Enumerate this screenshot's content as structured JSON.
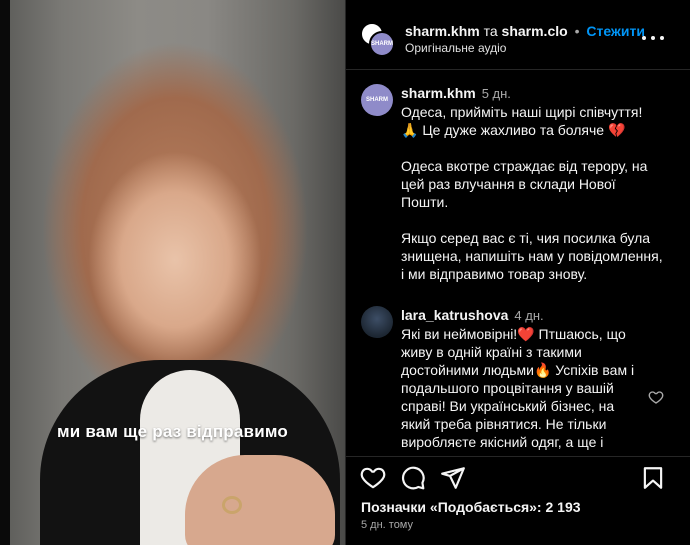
{
  "video": {
    "caption": "ми вам ще раз відправимо"
  },
  "header": {
    "user1": "sharm.khm",
    "joiner": "та",
    "user2": "sharm.clo",
    "separator": "•",
    "follow_label": "Стежити",
    "audio": "Оригінальне аудіо",
    "avatar_text": "SHARM",
    "more_icon": "more-horizontal-icon"
  },
  "comments": [
    {
      "username": "sharm.khm",
      "time": "5 дн.",
      "avatar_text": "SHARM",
      "lines": [
        "Одеса, прийміть наші щирі співчуття!",
        "🙏 Це дуже жахливо та боляче 💔",
        "",
        "Одеса вкотре страждає від терору, на",
        "цей раз влучання в склади Нової",
        "Пошти.",
        "",
        "Якщо серед вас є ті, чия посилка була",
        "знищена, напишіть нам у повідомлення,",
        "і ми відправимо товар знову."
      ]
    },
    {
      "username": "lara_katrushova",
      "time": "4 дн.",
      "lines": [
        "Які ви неймовірні!❤️ Птшаюсь, що",
        "живу в одній країні з такими",
        "достойними людьми🔥 Успіхів вам і",
        "подальшого процвітання у вашій",
        "справі! Ви український бізнес, на",
        "який треба рівнятися. Не тільки",
        "виробляєте якісний одяг, а ще і"
      ]
    }
  ],
  "actions": {
    "like_icon": "heart-icon",
    "comment_icon": "comment-icon",
    "share_icon": "send-icon",
    "save_icon": "bookmark-icon",
    "likes_text": "Позначки «Подобається»: 2 193",
    "posted": "5 дн. тому"
  },
  "colors": {
    "accent": "#0095f6",
    "background": "#000000",
    "muted": "#a8a8a8",
    "heart_red": "#e0245e"
  }
}
